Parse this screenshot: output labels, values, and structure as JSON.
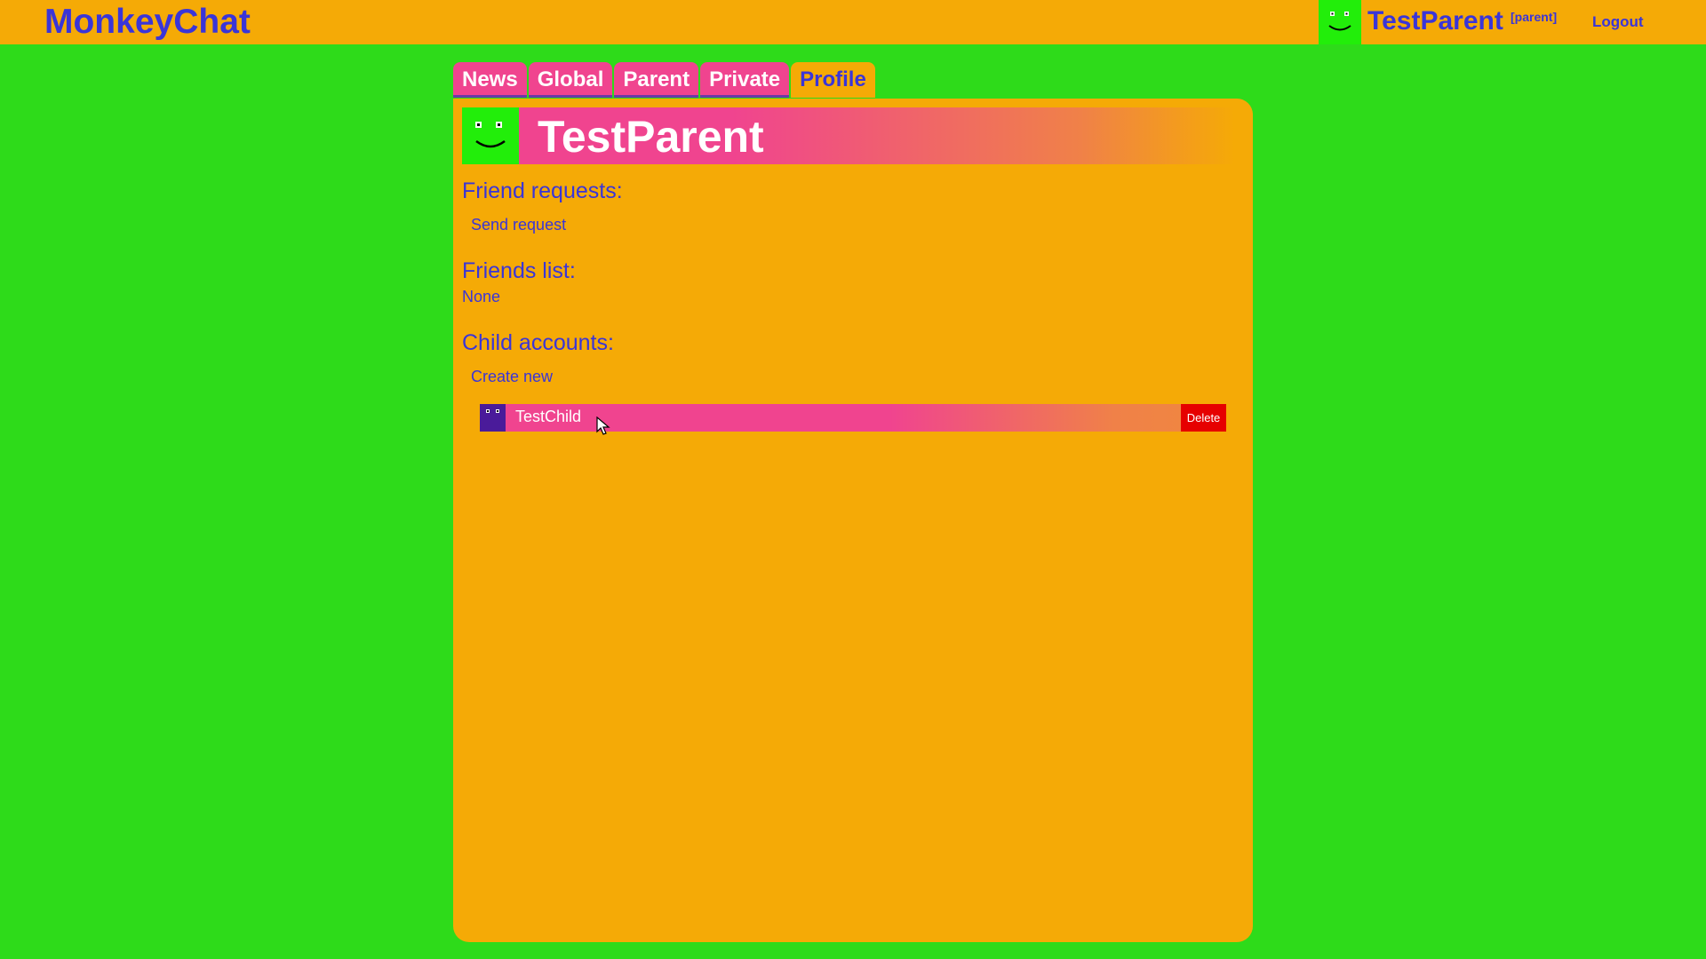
{
  "header": {
    "brand": "MonkeyChat",
    "user_name": "TestParent",
    "user_role": "[parent]",
    "logout_label": "Logout"
  },
  "tabs": [
    {
      "label": "News",
      "active": false
    },
    {
      "label": "Global",
      "active": false
    },
    {
      "label": "Parent",
      "active": false
    },
    {
      "label": "Private",
      "active": false
    },
    {
      "label": "Profile",
      "active": true
    }
  ],
  "profile": {
    "name": "TestParent",
    "friend_requests_title": "Friend requests:",
    "send_request_label": "Send request",
    "friends_list_title": "Friends list:",
    "friends_list_value": "None",
    "child_accounts_title": "Child accounts:",
    "create_new_label": "Create new",
    "children": [
      {
        "name": "TestChild",
        "delete_label": "Delete"
      }
    ]
  },
  "colors": {
    "background": "#2edb1a",
    "topbar": "#f5aa06",
    "panel": "#f5aa06",
    "accent_text": "#3a35d8",
    "tab": "#f0448f",
    "avatar_green": "#22ee0a",
    "avatar_purple": "#4a1b9a",
    "delete": "#e60000"
  },
  "icons": {
    "user_avatar": "smiley-face-icon",
    "child_avatar": "smiley-face-icon",
    "cursor": "mouse-pointer-icon"
  }
}
